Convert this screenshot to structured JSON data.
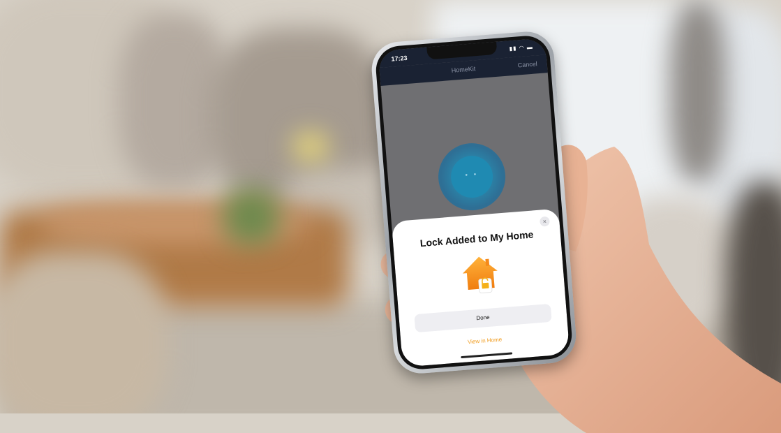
{
  "status_bar": {
    "time": "17:23",
    "icons": "▮▮ ◠ ▬"
  },
  "nav": {
    "title": "HomeKit",
    "cancel_label": "Cancel"
  },
  "scanner": {
    "dots": "• •"
  },
  "sheet": {
    "close_label": "×",
    "title": "Lock Added to My Home",
    "icon": "home-lock-icon",
    "done_label": "Done",
    "view_label": "View in Home"
  },
  "colors": {
    "accent": "#f09a1a",
    "nav_bg": "#1a2233",
    "scanner": "#1f8ab2"
  }
}
